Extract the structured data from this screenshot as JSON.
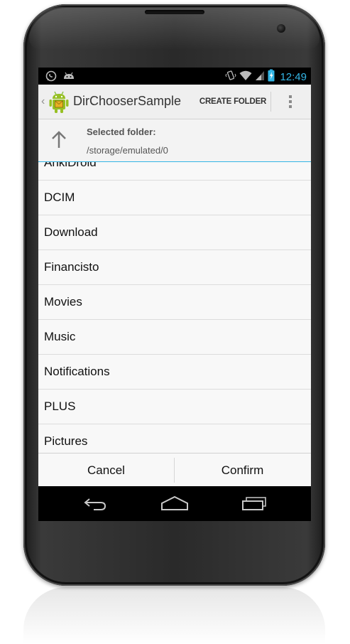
{
  "status_bar": {
    "time": "12:49",
    "left_icons": [
      "whatsapp-icon",
      "android-debug-icon"
    ],
    "right_icons": [
      "vibrate-icon",
      "wifi-icon",
      "signal-icon",
      "battery-charging-icon"
    ],
    "time_color": "#33b5e5"
  },
  "action_bar": {
    "title": "DirChooserSample",
    "create_folder_label": "CREATE FOLDER",
    "app_icon": "android-robot-icon",
    "overflow_icon": "overflow-menu-icon"
  },
  "header": {
    "up_icon": "arrow-up-icon",
    "selected_label": "Selected folder:",
    "selected_path": "/storage/emulated/0",
    "accent_color": "#33b5e5"
  },
  "folders": {
    "partial_item": "AnkiDroid",
    "items": [
      "DCIM",
      "Download",
      "Financisto",
      "Movies",
      "Music",
      "Notifications",
      "PLUS",
      "Pictures"
    ]
  },
  "buttons": {
    "cancel_label": "Cancel",
    "confirm_label": "Confirm"
  },
  "nav_bar": {
    "back_icon": "back-icon",
    "home_icon": "home-icon",
    "recents_icon": "recents-icon"
  }
}
